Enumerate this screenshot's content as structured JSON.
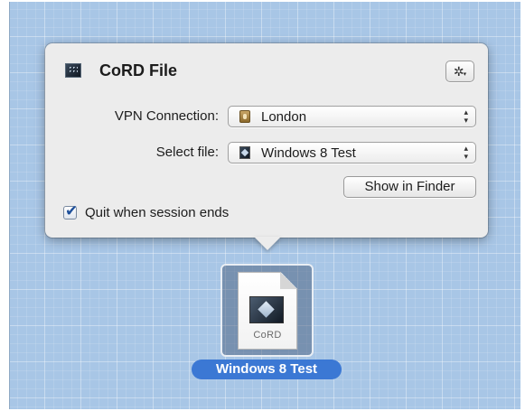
{
  "popover": {
    "title": "CoRD File",
    "vpn": {
      "label": "VPN Connection:",
      "value": "London",
      "icon": "vpn-lock-icon"
    },
    "file": {
      "label": "Select file:",
      "value": "Windows 8 Test",
      "icon": "cord-file-icon"
    },
    "show_in_finder_label": "Show in Finder",
    "quit_when_session_ends": {
      "label": "Quit when session ends",
      "checked": true
    },
    "gear_icon": "gear-icon"
  },
  "desktop": {
    "file_icon": {
      "doc_text": "CoRD",
      "name": "Windows 8 Test"
    }
  },
  "symbols": {
    "gear": "✲",
    "caret": "▾",
    "updown": "▴\n▾",
    "check": "✔"
  },
  "colors": {
    "selection_blue": "#3b78d4",
    "grid_blue": "#a8c6e6",
    "popover_bg": "#ececec"
  }
}
